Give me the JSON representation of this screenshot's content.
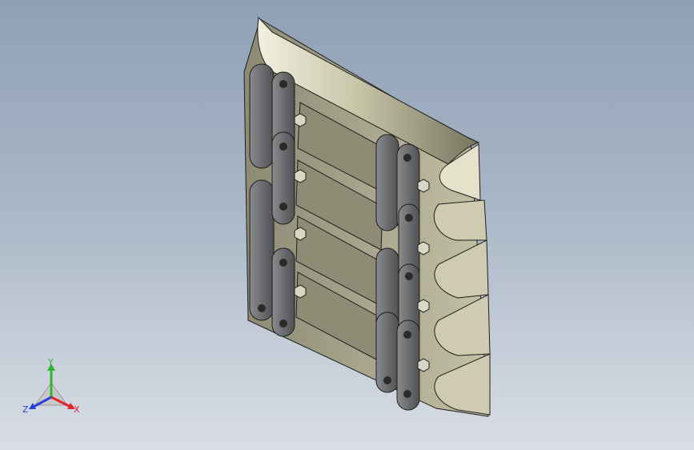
{
  "viewport": {
    "background": {
      "top": "#8fa0b6",
      "bottom": "#d9dee5"
    }
  },
  "model": {
    "description_icon": "conveyor-chain-scraper-assembly",
    "colors": {
      "plate_light": "#d6d3b8",
      "plate_mid": "#a9a68e",
      "plate_dark": "#6f6d5b",
      "link_light": "#7f8081",
      "link_dark": "#4d4e50",
      "edge": "#1e1e1e"
    }
  },
  "triad": {
    "x_label": "X",
    "y_label": "Y",
    "z_label": "Z",
    "x_color": "#e0262a",
    "y_color": "#2fb52f",
    "z_color": "#2b3fd8"
  }
}
